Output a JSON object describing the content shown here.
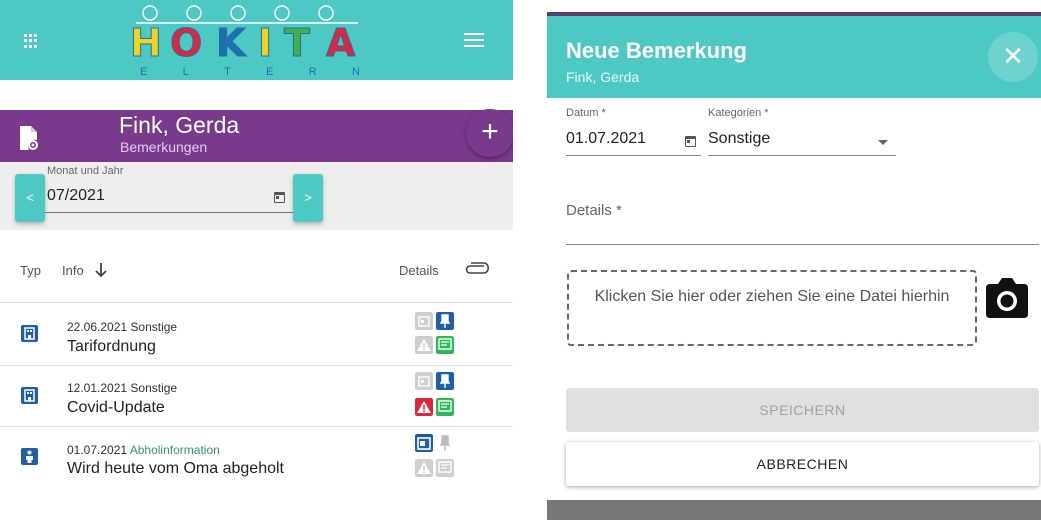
{
  "app": {
    "logo_text": "HOKITA",
    "logo_sub_letters": [
      "E",
      "L",
      "T",
      "E",
      "R",
      "N"
    ]
  },
  "child": {
    "name": "Fink, Gerda",
    "section": "Bemerkungen"
  },
  "month_picker": {
    "label": "Monat und Jahr",
    "value": "07/2021",
    "prev_label": "<",
    "next_label": ">"
  },
  "table": {
    "headers": {
      "typ": "Typ",
      "info": "Info",
      "details": "Details"
    },
    "rows": [
      {
        "date": "22.06.2021",
        "category": "Sonstige",
        "title": "Tarifordnung",
        "category_color": "default"
      },
      {
        "date": "12.01.2021",
        "category": "Sonstige",
        "title": "Covid-Update",
        "category_color": "default"
      },
      {
        "date": "01.07.2021",
        "category": "Abholinformation",
        "title": "Wird heute vom Oma abgeholt",
        "category_color": "#2e9b5f"
      }
    ]
  },
  "dialog": {
    "title": "Neue Bemerkung",
    "subtitle": "Fink, Gerda",
    "date_label": "Datum *",
    "date_value": "01.07.2021",
    "category_label": "Kategorien *",
    "category_value": "Sonstige",
    "details_label": "Details *",
    "dropzone_text": "Klicken Sie hier oder ziehen Sie eine Datei hierhin",
    "save_label": "SPEICHERN",
    "cancel_label": "ABBRECHEN"
  },
  "colors": {
    "teal": "#4ec8c2",
    "purple": "#7a3a8c",
    "blue": "#1f5fa8",
    "green": "#2e9b5f",
    "red": "#e0263a"
  },
  "icons": [
    "apps-grid-icon",
    "menu-icon",
    "document-view-icon",
    "add-icon",
    "calendar-icon",
    "sort-arrow-down-icon",
    "paperclip-icon",
    "building-icon",
    "person-icon",
    "calendar-icon",
    "pin-icon",
    "warning-icon",
    "chat-icon",
    "close-icon",
    "caret-down-icon",
    "camera-icon"
  ]
}
